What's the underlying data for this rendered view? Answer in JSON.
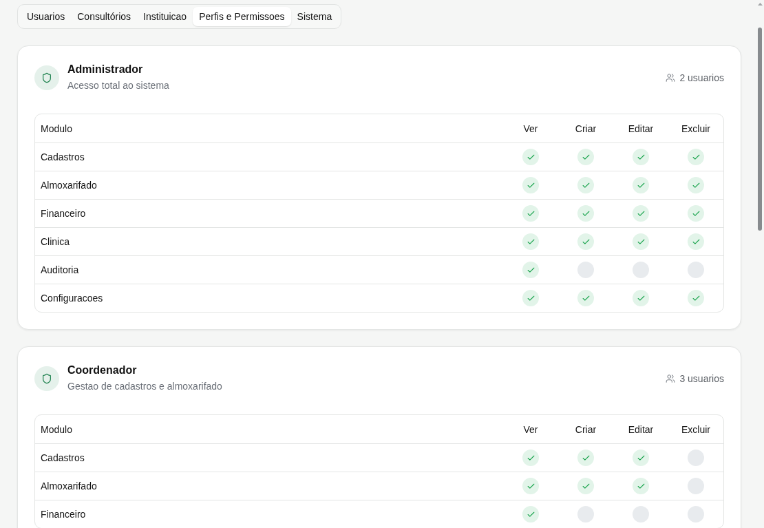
{
  "tabs": [
    {
      "label": "Usuarios",
      "selected": false
    },
    {
      "label": "Consultórios",
      "selected": false
    },
    {
      "label": "Instituicao",
      "selected": false
    },
    {
      "label": "Perfis e Permissoes",
      "selected": true
    },
    {
      "label": "Sistema",
      "selected": false
    }
  ],
  "profiles": [
    {
      "name": "Administrador",
      "description": "Acesso total ao sistema",
      "user_count": "2 usuarios",
      "columns": [
        "Modulo",
        "Ver",
        "Criar",
        "Editar",
        "Excluir"
      ],
      "rows": [
        {
          "module": "Cadastros",
          "permissions": [
            {
              "checked": true
            },
            {
              "checked": true
            },
            {
              "checked": true
            },
            {
              "checked": true
            }
          ]
        },
        {
          "module": "Almoxarifado",
          "permissions": [
            {
              "checked": true
            },
            {
              "checked": true
            },
            {
              "checked": true
            },
            {
              "checked": true
            }
          ]
        },
        {
          "module": "Financeiro",
          "permissions": [
            {
              "checked": true
            },
            {
              "checked": true
            },
            {
              "checked": true
            },
            {
              "checked": true
            }
          ]
        },
        {
          "module": "Clinica",
          "permissions": [
            {
              "checked": true
            },
            {
              "checked": true
            },
            {
              "checked": true
            },
            {
              "checked": true
            }
          ]
        },
        {
          "module": "Auditoria",
          "permissions": [
            {
              "checked": true
            },
            {
              "checked": false
            },
            {
              "checked": false
            },
            {
              "checked": false
            }
          ]
        },
        {
          "module": "Configuracoes",
          "permissions": [
            {
              "checked": true
            },
            {
              "checked": true
            },
            {
              "checked": true
            },
            {
              "checked": true
            }
          ]
        }
      ]
    },
    {
      "name": "Coordenador",
      "description": "Gestao de cadastros e almoxarifado",
      "user_count": "3 usuarios",
      "columns": [
        "Modulo",
        "Ver",
        "Criar",
        "Editar",
        "Excluir"
      ],
      "rows": [
        {
          "module": "Cadastros",
          "permissions": [
            {
              "checked": true
            },
            {
              "checked": true
            },
            {
              "checked": true
            },
            {
              "checked": false
            }
          ]
        },
        {
          "module": "Almoxarifado",
          "permissions": [
            {
              "checked": true
            },
            {
              "checked": true
            },
            {
              "checked": true
            },
            {
              "checked": false
            }
          ]
        },
        {
          "module": "Financeiro",
          "permissions": [
            {
              "checked": true
            },
            {
              "checked": false
            },
            {
              "checked": false
            },
            {
              "checked": false
            }
          ]
        }
      ]
    }
  ]
}
